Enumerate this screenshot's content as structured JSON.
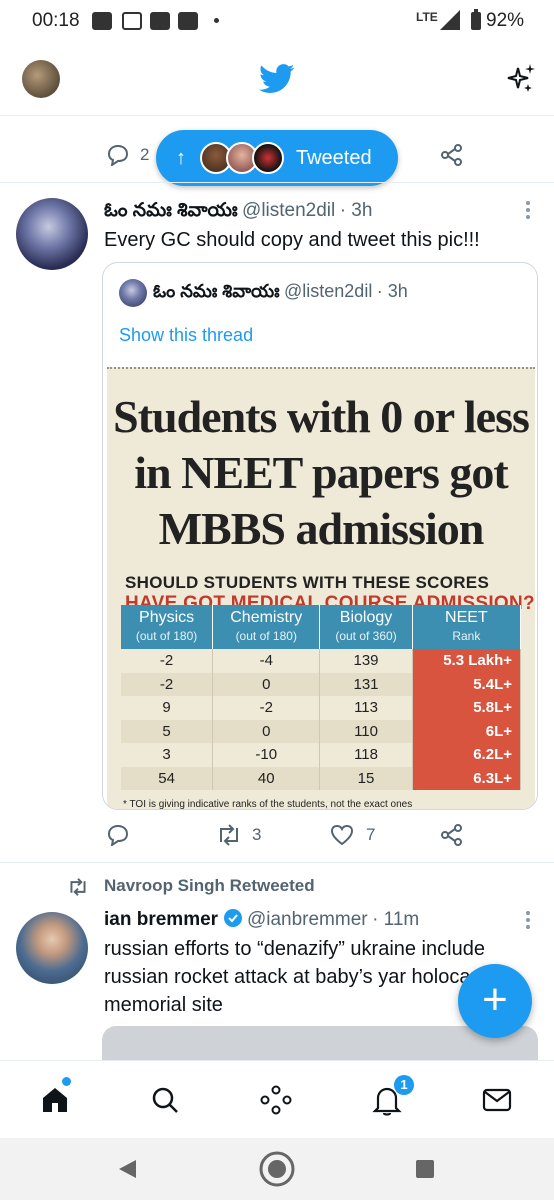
{
  "status_bar": {
    "time": "00:18",
    "network": "LTE",
    "battery": "92%"
  },
  "header": {
    "logo": "twitter-bird-icon",
    "right_icon": "sparkle-icon"
  },
  "prev_tweet": {
    "reply_count": "2"
  },
  "toast": {
    "label": "Tweeted"
  },
  "tweet1": {
    "name": "ఓం నమః శివాయః",
    "handle": "@listen2dil",
    "time": "· 3h",
    "text": "Every GC should copy and tweet this pic!!!",
    "quote": {
      "name": "ఓం నమః శివాయః",
      "handle": "@listen2dil",
      "time": "· 3h",
      "link": "Show this thread",
      "headline": "Students with 0 or less in NEET papers got MBBS admission",
      "sub1": "SHOULD STUDENTS WITH THESE SCORES",
      "sub2": "HAVE GOT MEDICAL COURSE ADMISSION?",
      "columns": [
        {
          "title": "Physics",
          "sub": "(out of 180)"
        },
        {
          "title": "Chemistry",
          "sub": "(out of 180)"
        },
        {
          "title": "Biology",
          "sub": "(out of 360)"
        },
        {
          "title": "NEET",
          "sub": "Rank"
        }
      ],
      "rows": [
        [
          "-2",
          "-4",
          "139",
          "5.3 Lakh+"
        ],
        [
          "-2",
          "0",
          "131",
          "5.4L+"
        ],
        [
          "9",
          "-2",
          "113",
          "5.8L+"
        ],
        [
          "5",
          "0",
          "110",
          "6L+"
        ],
        [
          "3",
          "-10",
          "118",
          "6.2L+"
        ],
        [
          "54",
          "40",
          "15",
          "6.3L+"
        ]
      ],
      "footnote": "* TOI is giving indicative ranks of the students, not the exact ones"
    },
    "retweets": "3",
    "likes": "7"
  },
  "tweet2": {
    "retweeted_by": "Navroop Singh Retweeted",
    "name": "ian bremmer",
    "handle": "@ianbremmer",
    "time": "· 11m",
    "text": "russian efforts to “denazify” ukraine include russian rocket attack at baby’s yar holocaust memorial site"
  },
  "bottom_nav": {
    "notifications_badge": "1"
  }
}
